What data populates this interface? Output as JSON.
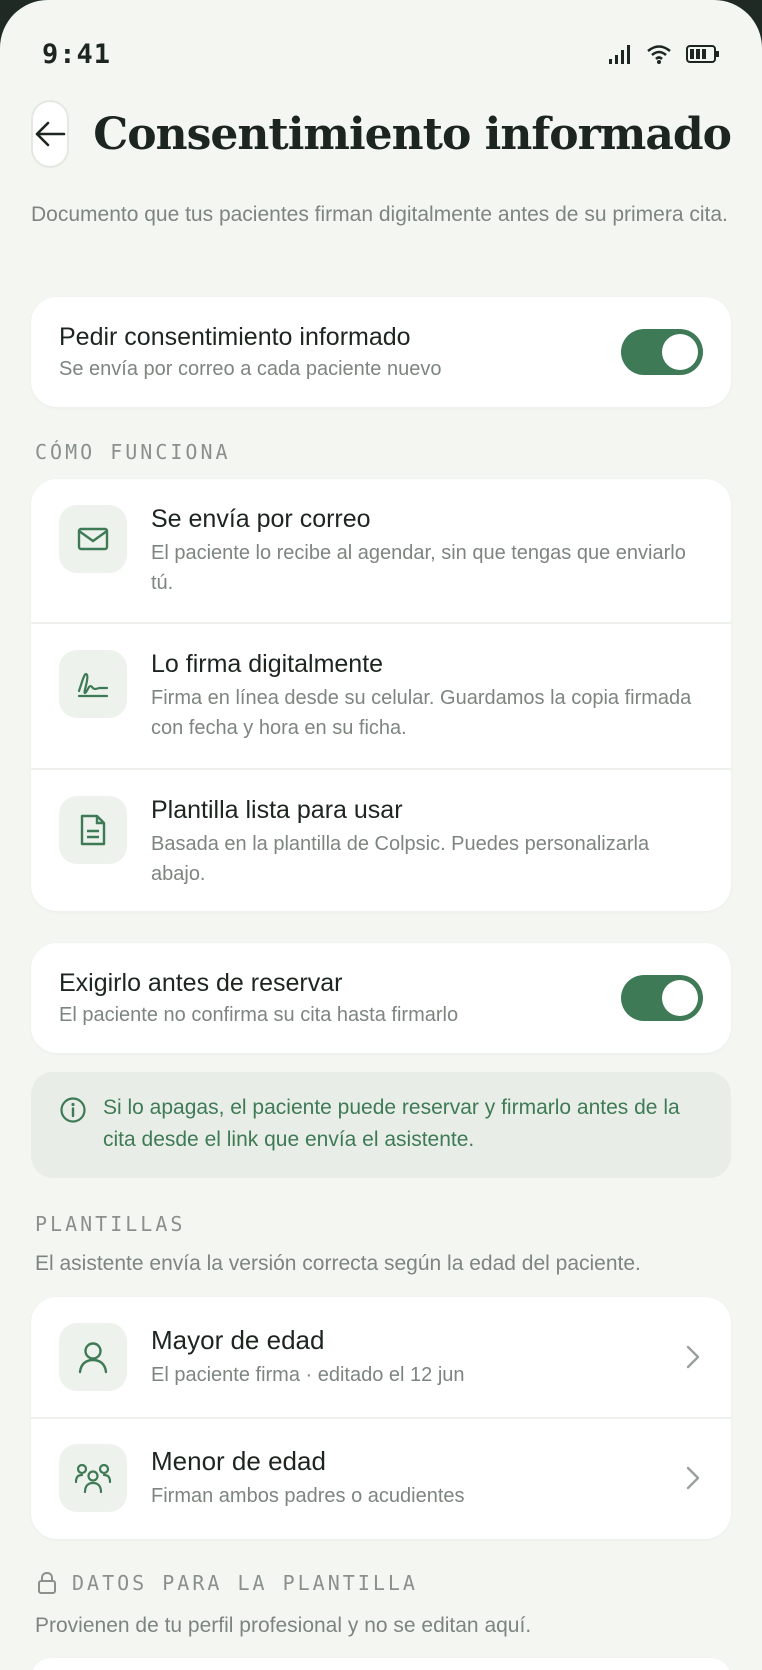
{
  "status_bar": {
    "time": "9:41"
  },
  "header": {
    "title": "Consentimiento informado"
  },
  "intro": "Documento que tus pacientes firman digitalmente antes de su primera cita.",
  "consent_toggle": {
    "title": "Pedir consentimiento informado",
    "subtitle": "Se envía por correo a cada paciente nuevo",
    "on": true
  },
  "how_it_works": {
    "label": "CÓMO FUNCIONA",
    "items": [
      {
        "icon": "mail-icon",
        "title": "Se envía por correo",
        "desc": "El paciente lo recibe al agendar, sin que tengas que enviarlo tú."
      },
      {
        "icon": "signature-icon",
        "title": "Lo firma digitalmente",
        "desc": "Firma en línea desde su celular. Guardamos la copia firmada con fecha y hora en su ficha."
      },
      {
        "icon": "document-icon",
        "title": "Plantilla lista para usar",
        "desc": "Basada en la plantilla de Colpsic. Puedes personalizarla abajo."
      }
    ]
  },
  "require_toggle": {
    "title": "Exigirlo antes de reservar",
    "subtitle": "El paciente no confirma su cita hasta firmarlo",
    "on": true
  },
  "info_note": "Si lo apagas, el paciente puede reservar y firmarlo antes de la cita desde el link que envía el asistente.",
  "templates": {
    "label": "PLANTILLAS",
    "description": "El asistente envía la versión correcta según la edad del paciente.",
    "items": [
      {
        "icon": "person-icon",
        "title": "Mayor de edad",
        "subtitle": "El paciente firma · editado el 12 jun"
      },
      {
        "icon": "group-icon",
        "title": "Menor de edad",
        "subtitle": "Firman ambos padres o acudientes"
      }
    ]
  },
  "template_data": {
    "label": "DATOS PARA LA PLANTILLA",
    "description": "Provienen de tu perfil profesional y no se editan aquí."
  },
  "colors": {
    "accent": "#3f7a56",
    "background": "#f4f6f2",
    "text": "#1c2520",
    "muted": "#7d8580"
  }
}
